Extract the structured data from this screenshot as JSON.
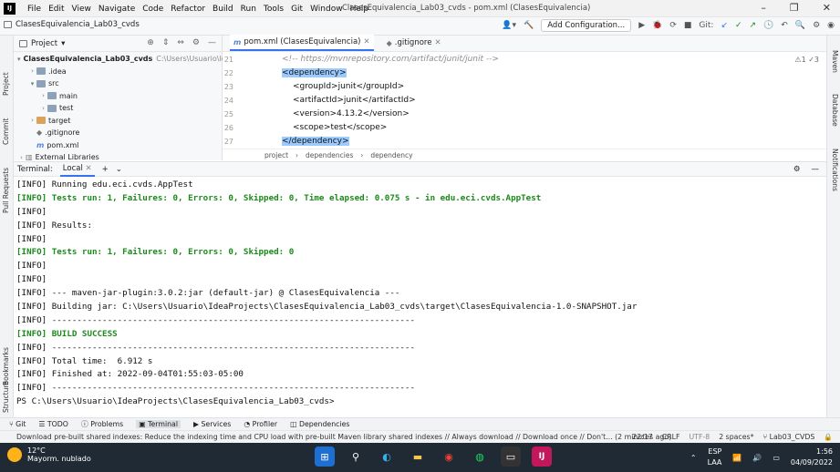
{
  "window": {
    "title": "ClasesEquivalencia_Lab03_cvds - pom.xml (ClasesEquivalencia)",
    "menu": [
      "File",
      "Edit",
      "View",
      "Navigate",
      "Code",
      "Refactor",
      "Build",
      "Run",
      "Tools",
      "Git",
      "Window",
      "Help"
    ]
  },
  "navbar": {
    "project_name": "ClasesEquivalencia_Lab03_cvds",
    "add_configuration": "Add Configuration...",
    "git_label": "Git:"
  },
  "left_tabs": [
    "Project",
    "Commit",
    "Pull Requests",
    "Bookmarks",
    "Structure"
  ],
  "right_tabs": [
    "Maven",
    "Database",
    "Notifications"
  ],
  "project_panel": {
    "title": "Project",
    "tree": [
      {
        "label": "ClasesEquivalencia_Lab03_cvds",
        "suffix": "C:\\Users\\Usuario\\IdeaP",
        "indent": 0,
        "arrow": "▾",
        "icon": "folder",
        "bold": true
      },
      {
        "label": ".idea",
        "indent": 1,
        "arrow": "›",
        "icon": "folder"
      },
      {
        "label": "src",
        "indent": 1,
        "arrow": "▾",
        "icon": "folder"
      },
      {
        "label": "main",
        "indent": 2,
        "arrow": "›",
        "icon": "folder"
      },
      {
        "label": "test",
        "indent": 2,
        "arrow": "›",
        "icon": "folder"
      },
      {
        "label": "target",
        "indent": 1,
        "arrow": "›",
        "icon": "folder orange"
      },
      {
        "label": ".gitignore",
        "indent": 1,
        "arrow": "",
        "icon": "file"
      },
      {
        "label": "pom.xml",
        "indent": 1,
        "arrow": "",
        "icon": "m"
      },
      {
        "label": "External Libraries",
        "indent": 0,
        "arrow": "›",
        "icon": "lib"
      }
    ]
  },
  "editor": {
    "tabs": [
      {
        "label": "pom.xml (ClasesEquivalencia)",
        "active": true,
        "icon": "m"
      },
      {
        "label": ".gitignore",
        "active": false,
        "icon": "git"
      }
    ],
    "lines": [
      {
        "num": "21",
        "text": "<!-- https://mvnrepository.com/artifact/junit/junit -->"
      },
      {
        "num": "22",
        "text": "<dependency>"
      },
      {
        "num": "23",
        "text": "<groupId>junit</groupId>"
      },
      {
        "num": "24",
        "text": "<artifactId>junit</artifactId>"
      },
      {
        "num": "25",
        "text": "<version>4.13.2</version>"
      },
      {
        "num": "26",
        "text": "<scope>test</scope>"
      },
      {
        "num": "27",
        "text": "</dependency>"
      }
    ],
    "inspections": "⚠1 ✓3",
    "breadcrumbs": [
      "project",
      "dependencies",
      "dependency"
    ]
  },
  "terminal": {
    "title": "Terminal:",
    "tab": "Local",
    "lines": [
      "[INFO] Running edu.eci.cvds.AppTest",
      "[INFO] Tests run: 1, Failures: 0, Errors: 0, Skipped: 0, Time elapsed: 0.075 s - in edu.eci.cvds.AppTest",
      "[INFO]",
      "[INFO] Results:",
      "[INFO]",
      "[INFO] Tests run: 1, Failures: 0, Errors: 0, Skipped: 0",
      "[INFO]",
      "[INFO]",
      "[INFO] --- maven-jar-plugin:3.0.2:jar (default-jar) @ ClasesEquivalencia ---",
      "[INFO] Building jar: C:\\Users\\Usuario\\IdeaProjects\\ClasesEquivalencia_Lab03_cvds\\target\\ClasesEquivalencia-1.0-SNAPSHOT.jar",
      "[INFO] ------------------------------------------------------------------------",
      "[INFO] BUILD SUCCESS",
      "[INFO] ------------------------------------------------------------------------",
      "[INFO] Total time:  6.912 s",
      "[INFO] Finished at: 2022-09-04T01:55:03-05:00",
      "[INFO] ------------------------------------------------------------------------",
      "PS C:\\Users\\Usuario\\IdeaProjects\\ClasesEquivalencia_Lab03_cvds>"
    ]
  },
  "tool_windows": [
    "Git",
    "TODO",
    "Problems",
    "Terminal",
    "Services",
    "Profiler",
    "Dependencies"
  ],
  "statusbar": {
    "message": "Download pre-built shared indexes: Reduce the indexing time and CPU load with pre-built Maven library shared indexes // Always download // Download once // Don't... (2 minutes ago)",
    "position": "22:17",
    "line_sep": "CRLF",
    "encoding": "UTF-8",
    "indent": "2 spaces*",
    "branch": "Lab03_CVDS"
  },
  "taskbar": {
    "temp": "12°C",
    "weather": "Mayorm. nublado",
    "lang": "ESP",
    "lang2": "LAA",
    "time": "1:56",
    "date": "04/09/2022"
  },
  "colors": {
    "accent": "#3574f0",
    "success": "#1a8a1a",
    "selection": "#9bcaff"
  }
}
